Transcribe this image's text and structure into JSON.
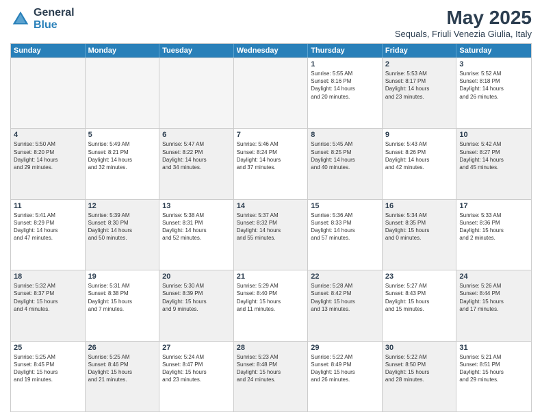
{
  "logo": {
    "general": "General",
    "blue": "Blue"
  },
  "title": "May 2025",
  "subtitle": "Sequals, Friuli Venezia Giulia, Italy",
  "weekdays": [
    "Sunday",
    "Monday",
    "Tuesday",
    "Wednesday",
    "Thursday",
    "Friday",
    "Saturday"
  ],
  "weeks": [
    [
      {
        "day": "",
        "info": "",
        "empty": true
      },
      {
        "day": "",
        "info": "",
        "empty": true
      },
      {
        "day": "",
        "info": "",
        "empty": true
      },
      {
        "day": "",
        "info": "",
        "empty": true
      },
      {
        "day": "1",
        "info": "Sunrise: 5:55 AM\nSunset: 8:16 PM\nDaylight: 14 hours\nand 20 minutes.",
        "empty": false
      },
      {
        "day": "2",
        "info": "Sunrise: 5:53 AM\nSunset: 8:17 PM\nDaylight: 14 hours\nand 23 minutes.",
        "empty": false,
        "shaded": true
      },
      {
        "day": "3",
        "info": "Sunrise: 5:52 AM\nSunset: 8:18 PM\nDaylight: 14 hours\nand 26 minutes.",
        "empty": false
      }
    ],
    [
      {
        "day": "4",
        "info": "Sunrise: 5:50 AM\nSunset: 8:20 PM\nDaylight: 14 hours\nand 29 minutes.",
        "empty": false,
        "shaded": true
      },
      {
        "day": "5",
        "info": "Sunrise: 5:49 AM\nSunset: 8:21 PM\nDaylight: 14 hours\nand 32 minutes.",
        "empty": false
      },
      {
        "day": "6",
        "info": "Sunrise: 5:47 AM\nSunset: 8:22 PM\nDaylight: 14 hours\nand 34 minutes.",
        "empty": false,
        "shaded": true
      },
      {
        "day": "7",
        "info": "Sunrise: 5:46 AM\nSunset: 8:24 PM\nDaylight: 14 hours\nand 37 minutes.",
        "empty": false
      },
      {
        "day": "8",
        "info": "Sunrise: 5:45 AM\nSunset: 8:25 PM\nDaylight: 14 hours\nand 40 minutes.",
        "empty": false,
        "shaded": true
      },
      {
        "day": "9",
        "info": "Sunrise: 5:43 AM\nSunset: 8:26 PM\nDaylight: 14 hours\nand 42 minutes.",
        "empty": false
      },
      {
        "day": "10",
        "info": "Sunrise: 5:42 AM\nSunset: 8:27 PM\nDaylight: 14 hours\nand 45 minutes.",
        "empty": false,
        "shaded": true
      }
    ],
    [
      {
        "day": "11",
        "info": "Sunrise: 5:41 AM\nSunset: 8:29 PM\nDaylight: 14 hours\nand 47 minutes.",
        "empty": false
      },
      {
        "day": "12",
        "info": "Sunrise: 5:39 AM\nSunset: 8:30 PM\nDaylight: 14 hours\nand 50 minutes.",
        "empty": false,
        "shaded": true
      },
      {
        "day": "13",
        "info": "Sunrise: 5:38 AM\nSunset: 8:31 PM\nDaylight: 14 hours\nand 52 minutes.",
        "empty": false
      },
      {
        "day": "14",
        "info": "Sunrise: 5:37 AM\nSunset: 8:32 PM\nDaylight: 14 hours\nand 55 minutes.",
        "empty": false,
        "shaded": true
      },
      {
        "day": "15",
        "info": "Sunrise: 5:36 AM\nSunset: 8:33 PM\nDaylight: 14 hours\nand 57 minutes.",
        "empty": false
      },
      {
        "day": "16",
        "info": "Sunrise: 5:34 AM\nSunset: 8:35 PM\nDaylight: 15 hours\nand 0 minutes.",
        "empty": false,
        "shaded": true
      },
      {
        "day": "17",
        "info": "Sunrise: 5:33 AM\nSunset: 8:36 PM\nDaylight: 15 hours\nand 2 minutes.",
        "empty": false
      }
    ],
    [
      {
        "day": "18",
        "info": "Sunrise: 5:32 AM\nSunset: 8:37 PM\nDaylight: 15 hours\nand 4 minutes.",
        "empty": false,
        "shaded": true
      },
      {
        "day": "19",
        "info": "Sunrise: 5:31 AM\nSunset: 8:38 PM\nDaylight: 15 hours\nand 7 minutes.",
        "empty": false
      },
      {
        "day": "20",
        "info": "Sunrise: 5:30 AM\nSunset: 8:39 PM\nDaylight: 15 hours\nand 9 minutes.",
        "empty": false,
        "shaded": true
      },
      {
        "day": "21",
        "info": "Sunrise: 5:29 AM\nSunset: 8:40 PM\nDaylight: 15 hours\nand 11 minutes.",
        "empty": false
      },
      {
        "day": "22",
        "info": "Sunrise: 5:28 AM\nSunset: 8:42 PM\nDaylight: 15 hours\nand 13 minutes.",
        "empty": false,
        "shaded": true
      },
      {
        "day": "23",
        "info": "Sunrise: 5:27 AM\nSunset: 8:43 PM\nDaylight: 15 hours\nand 15 minutes.",
        "empty": false
      },
      {
        "day": "24",
        "info": "Sunrise: 5:26 AM\nSunset: 8:44 PM\nDaylight: 15 hours\nand 17 minutes.",
        "empty": false,
        "shaded": true
      }
    ],
    [
      {
        "day": "25",
        "info": "Sunrise: 5:25 AM\nSunset: 8:45 PM\nDaylight: 15 hours\nand 19 minutes.",
        "empty": false
      },
      {
        "day": "26",
        "info": "Sunrise: 5:25 AM\nSunset: 8:46 PM\nDaylight: 15 hours\nand 21 minutes.",
        "empty": false,
        "shaded": true
      },
      {
        "day": "27",
        "info": "Sunrise: 5:24 AM\nSunset: 8:47 PM\nDaylight: 15 hours\nand 23 minutes.",
        "empty": false
      },
      {
        "day": "28",
        "info": "Sunrise: 5:23 AM\nSunset: 8:48 PM\nDaylight: 15 hours\nand 24 minutes.",
        "empty": false,
        "shaded": true
      },
      {
        "day": "29",
        "info": "Sunrise: 5:22 AM\nSunset: 8:49 PM\nDaylight: 15 hours\nand 26 minutes.",
        "empty": false
      },
      {
        "day": "30",
        "info": "Sunrise: 5:22 AM\nSunset: 8:50 PM\nDaylight: 15 hours\nand 28 minutes.",
        "empty": false,
        "shaded": true
      },
      {
        "day": "31",
        "info": "Sunrise: 5:21 AM\nSunset: 8:51 PM\nDaylight: 15 hours\nand 29 minutes.",
        "empty": false
      }
    ]
  ]
}
